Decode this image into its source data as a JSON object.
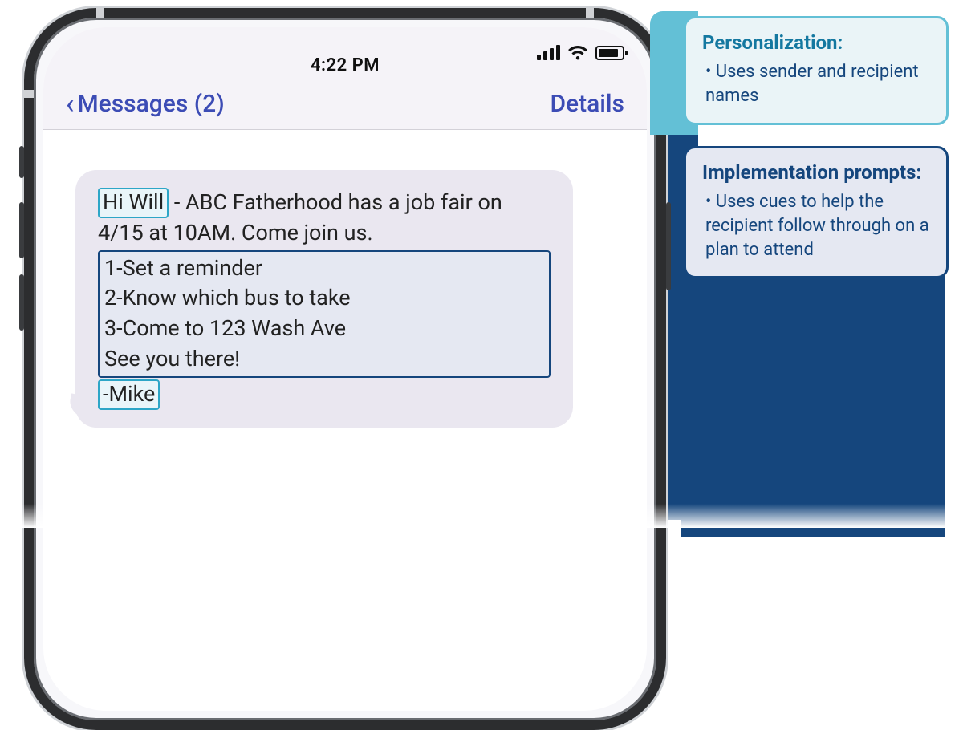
{
  "status": {
    "time": "4:22 PM"
  },
  "nav": {
    "back_label": "Messages (2)",
    "details_label": "Details"
  },
  "message": {
    "greeting": "Hi Will",
    "body_after_greeting": " - ABC Fatherhood has a job fair on 4/15 at 10AM. Come join us.",
    "steps_combined": "1-Set a reminder\n2-Know which bus to take\n3-Come to 123 Wash Ave\nSee you there!",
    "signature": "-Mike"
  },
  "callouts": {
    "personalization": {
      "title": "Personalization:",
      "bullet": "Uses sender and recipient names"
    },
    "implementation": {
      "title": "Implementation prompts:",
      "bullet": "Uses cues to help the recipient follow through on a plan to attend"
    }
  }
}
